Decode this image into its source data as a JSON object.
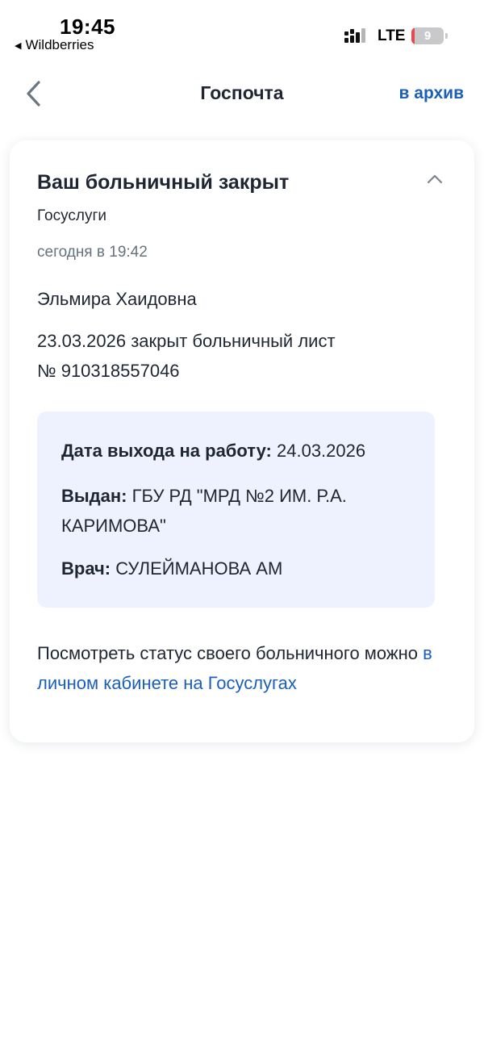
{
  "status_bar": {
    "time": "19:45",
    "back_app_label": "Wildberries",
    "network": "LTE",
    "battery_level": "9",
    "battery_fraction": 0.09,
    "battery_fill_color": "#e84a4a"
  },
  "nav": {
    "back_icon": "chevron-left-icon",
    "title": "Госпочта",
    "archive_label": "в архив"
  },
  "message": {
    "title": "Ваш больничный закрыт",
    "collapse_icon": "chevron-up-icon",
    "sender": "Госуслуги",
    "date": "сегодня в 19:42",
    "recipient_name": "Эльмира Хаидовна",
    "body_line1": "23.03.2026 закрыт больничный лист",
    "body_line2": "№ 910318557046",
    "details": {
      "return_date_label": "Дата выхода на работу:",
      "return_date_value": "24.03.2026",
      "issued_label": "Выдан:",
      "issued_value": "ГБУ РД \"МРД №2 ИМ. Р.А. КАРИМОВА\"",
      "doctor_label": "Врач:",
      "doctor_value": "СУЛЕЙМАНОВА АМ"
    },
    "footer_text": "Посмотреть статус своего больничного можно",
    "footer_link": "в личном кабинете на Госуслугах"
  },
  "colors": {
    "accent": "#1b5fb8",
    "text": "#1f2633",
    "muted": "#66727f",
    "details_bg": "#edf2fe"
  }
}
